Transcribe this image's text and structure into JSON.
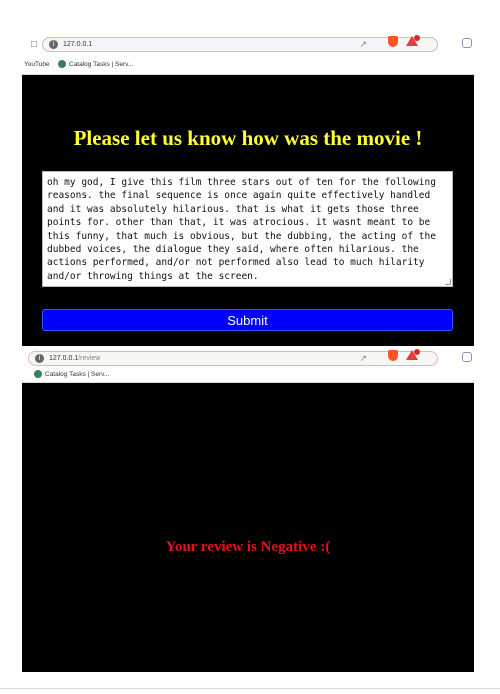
{
  "colors": {
    "page_bg": "#000000",
    "heading": "#ffff33",
    "submit_bg": "#0000ff",
    "negative_text": "#e8101a"
  },
  "form_screen": {
    "browser": {
      "url": "127.0.0.1",
      "bookmarks": [
        "YouTube",
        "Catalog Tasks | Serv..."
      ]
    },
    "heading": "Please let us know how was the movie !",
    "review_text": "oh my god, I give this film three stars out of ten for the following reasons. the final sequence is once again quite effectively handled and it was absolutely hilarious. that is what it gets those three points for. other than that, it was atrocious. it wasnt meant to be this funny, that much is obvious, but the dubbing, the acting of the dubbed voices, the dialogue they said, where often hilarious. the actions performed, and/or not performed also lead to much hilarity and/or throwing things at the screen.",
    "submit_label": "Submit"
  },
  "result_screen": {
    "browser": {
      "url_host": "127.0.0.1",
      "url_path": "/review",
      "bookmarks": [
        "Catalog Tasks | Serv..."
      ]
    },
    "result_text": "Your review is Negative :("
  },
  "icons": [
    "bookmark-icon",
    "site-info-icon",
    "share-icon",
    "brave-shields-icon",
    "brave-rewards-icon",
    "extension-icon",
    "github-icon"
  ]
}
